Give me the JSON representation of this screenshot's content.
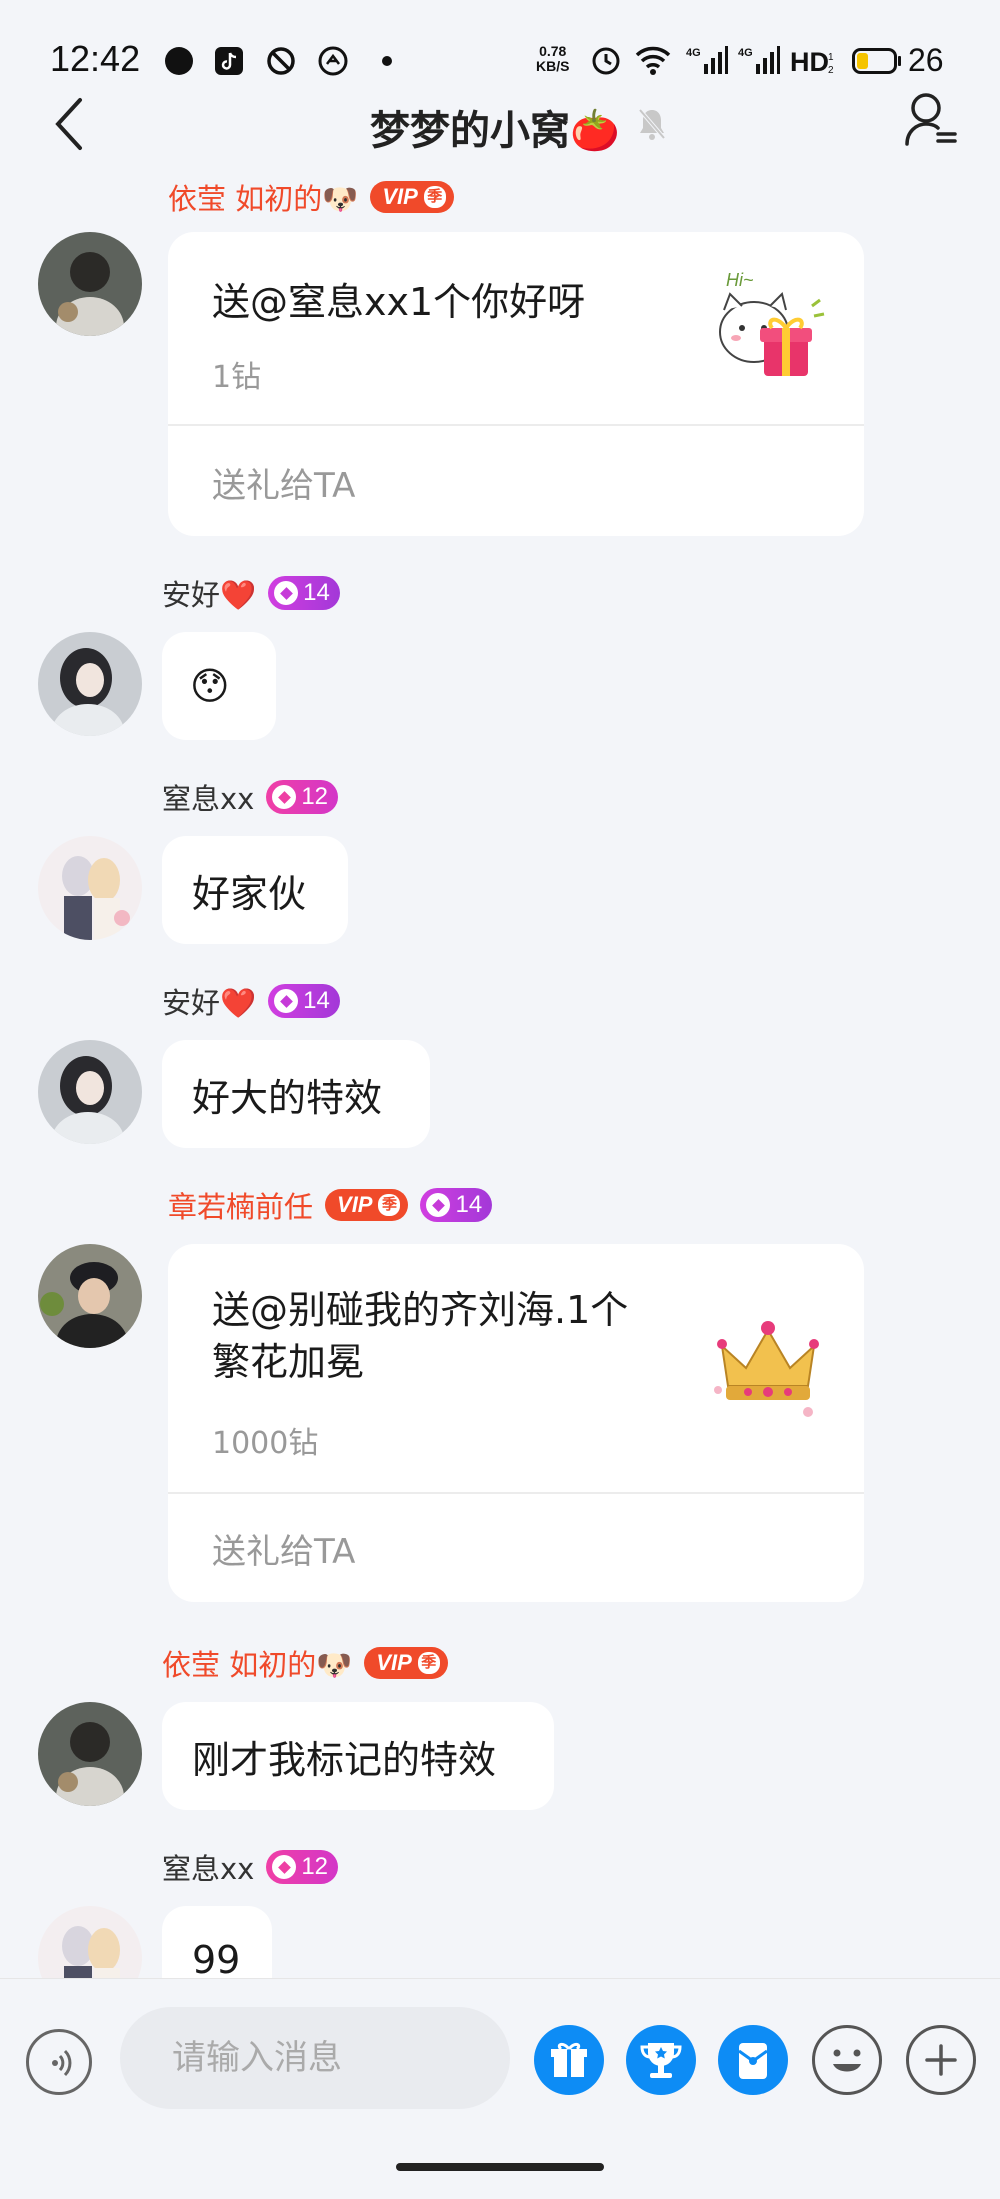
{
  "status_bar": {
    "time": "12:42",
    "net_speed_value": "0.78",
    "net_speed_unit": "KB/S",
    "battery_level": "26"
  },
  "header": {
    "title": "梦梦的小窝🍅"
  },
  "messages": [
    {
      "type": "gift",
      "sender": "依莹 如初的🐶",
      "vip": "VIP",
      "vip_season": "季",
      "gift_text": "送@窒息xx1个你好呀",
      "price": "1钻",
      "action": "送礼给TA"
    },
    {
      "type": "text",
      "sender": "安好❤️",
      "level": "14",
      "text": "😯"
    },
    {
      "type": "text",
      "sender": "窒息xx",
      "level": "12",
      "text": "好家伙"
    },
    {
      "type": "text",
      "sender": "安好❤️",
      "level": "14",
      "text": "好大的特效"
    },
    {
      "type": "gift",
      "sender": "章若楠前任",
      "vip": "VIP",
      "vip_season": "季",
      "level": "14",
      "gift_text_line1": "送@别碰我的齐刘海.1个",
      "gift_text_line2": "繁花加冕",
      "price": "1000钻",
      "action": "送礼给TA"
    },
    {
      "type": "text",
      "sender": "依莹 如初的🐶",
      "vip": "VIP",
      "vip_season": "季",
      "text": "刚才我标记的特效"
    },
    {
      "type": "text",
      "sender": "窒息xx",
      "level": "12",
      "text": "99"
    }
  ],
  "input_bar": {
    "placeholder": "请输入消息"
  },
  "colors": {
    "accent_blue": "#0d8cf5",
    "name_red": "#f04a2a",
    "background": "#f3f5f9"
  }
}
